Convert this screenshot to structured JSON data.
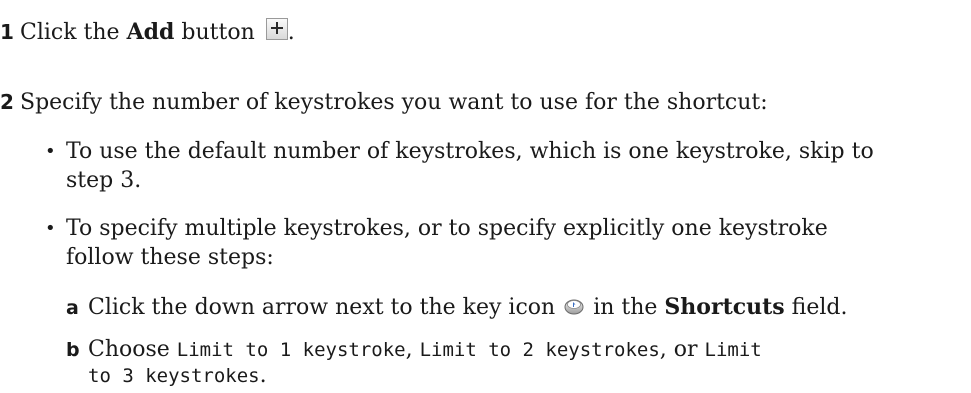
{
  "step1": {
    "number": "1",
    "text_before": "Click the ",
    "bold": "Add",
    "text_after": " button",
    "end": ".",
    "icon": "add-plus-icon"
  },
  "step2": {
    "number": "2",
    "text": "Specify the number of keystrokes you want to use for the shortcut:"
  },
  "bullet1": {
    "line1": "To use the default number of keystrokes, which is one keystroke, skip to",
    "line2": "step 3."
  },
  "bullet2": {
    "line1": "To specify multiple keystrokes, or to specify explicitly one keystroke",
    "line2": "follow these steps:"
  },
  "substep_a": {
    "letter": "a",
    "text_before": "Click the down arrow next to the key icon",
    "text_mid": " in the ",
    "bold": "Shortcuts",
    "text_after": " field.",
    "icon": "key-icon"
  },
  "substep_b": {
    "letter": "b",
    "text_before": "Choose ",
    "option1": "Limit to 1 keystroke",
    "sep1": ", ",
    "option2": "Limit to 2 keystrokes",
    "sep2": ", or ",
    "option3_part1": "Limit",
    "option3_part2": "to 3 keystrokes",
    "end": "."
  }
}
